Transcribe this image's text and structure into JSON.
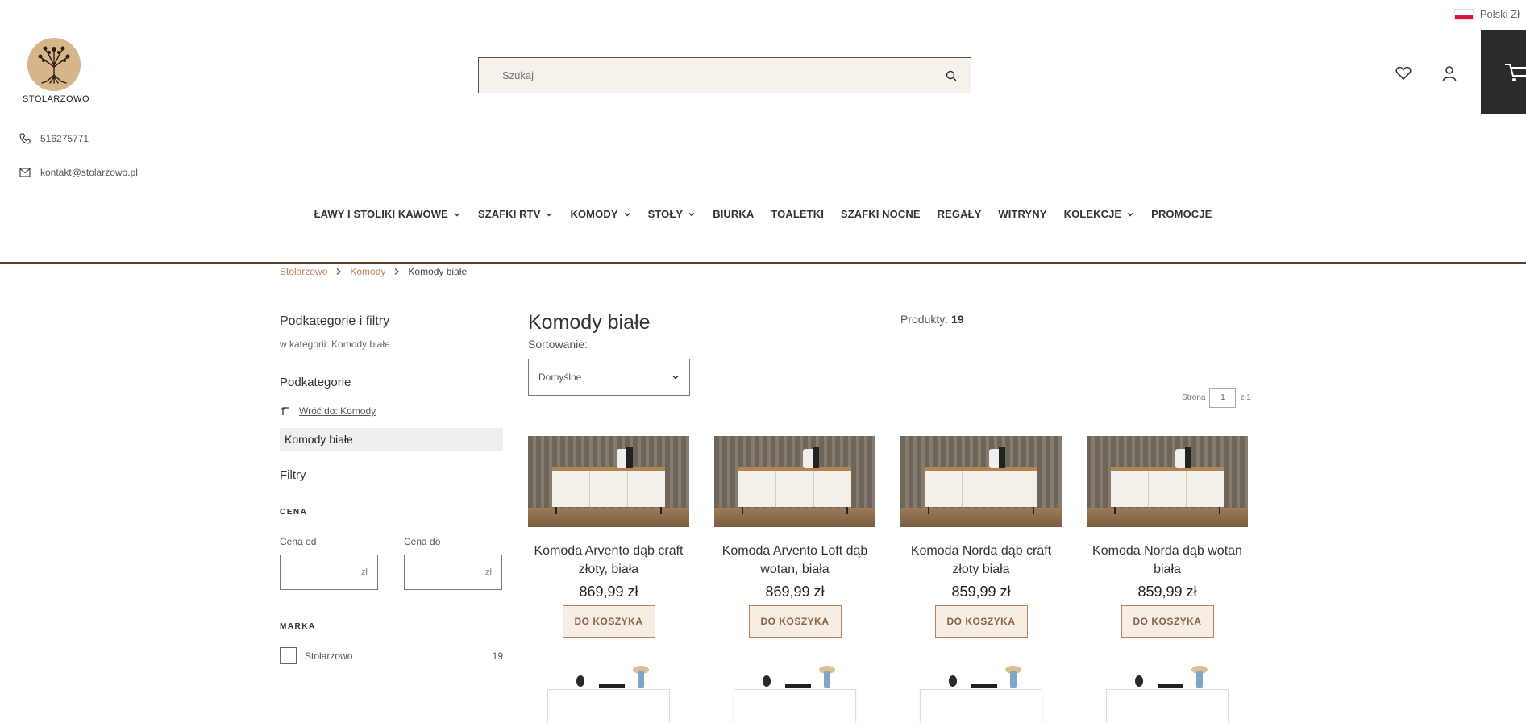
{
  "header": {
    "lang_label": "Polski Zł",
    "logo_text": "STOLARZOWO",
    "search_placeholder": "Szukaj",
    "phone": "516275771",
    "email": "kontakt@stolarzowo.pl"
  },
  "nav": {
    "items": [
      {
        "label": "ŁAWY I STOLIKI KAWOWE",
        "dropdown": true
      },
      {
        "label": "SZAFKI RTV",
        "dropdown": true
      },
      {
        "label": "KOMODY",
        "dropdown": true
      },
      {
        "label": "STOŁY",
        "dropdown": true
      },
      {
        "label": "BIURKA",
        "dropdown": false
      },
      {
        "label": "TOALETKI",
        "dropdown": false
      },
      {
        "label": "SZAFKI NOCNE",
        "dropdown": false
      },
      {
        "label": "REGAŁY",
        "dropdown": false
      },
      {
        "label": "WITRYNY",
        "dropdown": false
      },
      {
        "label": "KOLEKCJE",
        "dropdown": true
      },
      {
        "label": "PROMOCJE",
        "dropdown": false
      }
    ]
  },
  "breadcrumb": {
    "items": [
      "Stolarzowo",
      "Komody"
    ],
    "current": "Komody białe"
  },
  "sidebar": {
    "title": "Podkategorie i filtry",
    "subtitle": "w kategorii: Komody białe",
    "subcategories_heading": "Podkategorie",
    "back_link": "Wróć do: Komody",
    "active_category": "Komody białe",
    "filters_heading": "Filtry",
    "price_heading": "CENA",
    "price_from_label": "Cena od",
    "price_to_label": "Cena do",
    "price_unit": "zł",
    "brand_heading": "MARKA",
    "brand_name": "Stolarzowo",
    "brand_count": "19"
  },
  "main": {
    "title": "Komody białe",
    "count_label": "Produkty:",
    "count_value": "19",
    "sort_label": "Sortowanie:",
    "sort_value": "Domyślne",
    "pager_label": "Strona",
    "pager_value": "1",
    "pager_total": "z 1"
  },
  "products": [
    {
      "name": "Komoda Arvento dąb craft złoty, biała",
      "price": "869,99 zł",
      "button": "DO KOSZYKA"
    },
    {
      "name": "Komoda Arvento Loft dąb wotan, biała",
      "price": "869,99 zł",
      "button": "DO KOSZYKA"
    },
    {
      "name": "Komoda Norda dąb craft złoty biała",
      "price": "859,99 zł",
      "button": "DO KOSZYKA"
    },
    {
      "name": "Komoda Norda dąb wotan biała",
      "price": "859,99 zł",
      "button": "DO KOSZYKA"
    }
  ],
  "colors": {
    "accent": "#b48564",
    "nav_line": "#5a3e2b",
    "search_bg": "#f6f1ea",
    "cart_bg": "#2b2b2b",
    "button_bg": "#f6ede4"
  },
  "icons": [
    "flag-pl-icon",
    "search-icon",
    "heart-icon",
    "user-icon",
    "cart-icon",
    "phone-icon",
    "mail-icon",
    "chevron-down-icon",
    "chevron-right-icon",
    "back-arrow-icon"
  ]
}
